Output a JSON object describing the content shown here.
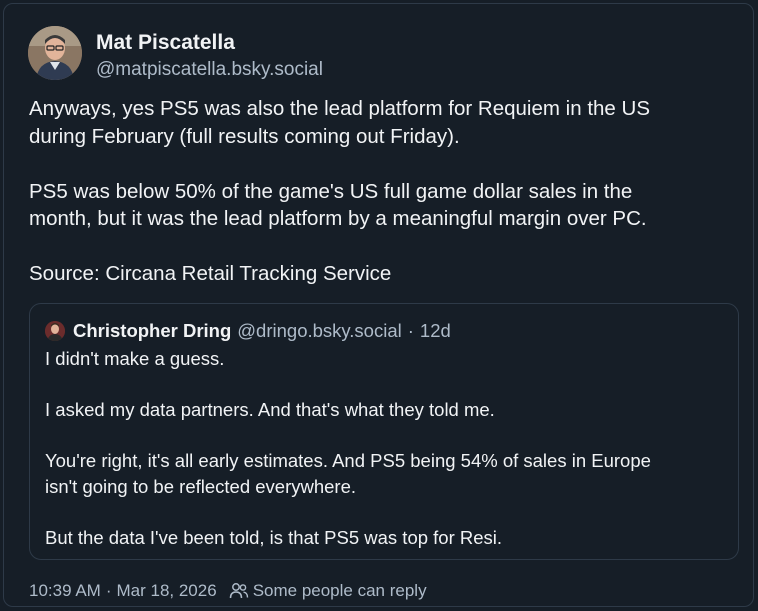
{
  "post": {
    "author": {
      "name": "Mat Piscatella",
      "handle": "@matpiscatella.bsky.social"
    },
    "paragraphs": [
      [
        "Anyways, yes PS5 was also the lead platform for Requiem in the US",
        "during February (full results coming out Friday)."
      ],
      [
        "PS5 was below 50% of the game's US full game dollar sales in the",
        "month, but it was the lead platform by a meaningful margin over PC."
      ],
      [
        "Source: Circana Retail Tracking Service"
      ]
    ],
    "quote": {
      "author_name": "Christopher Dring",
      "author_handle": "@dringo.bsky.social",
      "separator": "·",
      "age": "12d",
      "paragraphs": [
        [
          "I didn't make a guess."
        ],
        [
          "I asked my data partners. And that's what they told me."
        ],
        [
          "You're right, it's all early estimates. And PS5 being 54% of sales in Europe",
          "isn't going to be reflected everywhere."
        ],
        [
          "But the data I've been told, is that PS5 was top for Resi."
        ]
      ]
    },
    "footer": {
      "time": "10:39 AM",
      "separator": "·",
      "date": "Mar 18, 2026",
      "reply_setting": "Some people can reply",
      "reply_icon": "people-icon"
    }
  }
}
